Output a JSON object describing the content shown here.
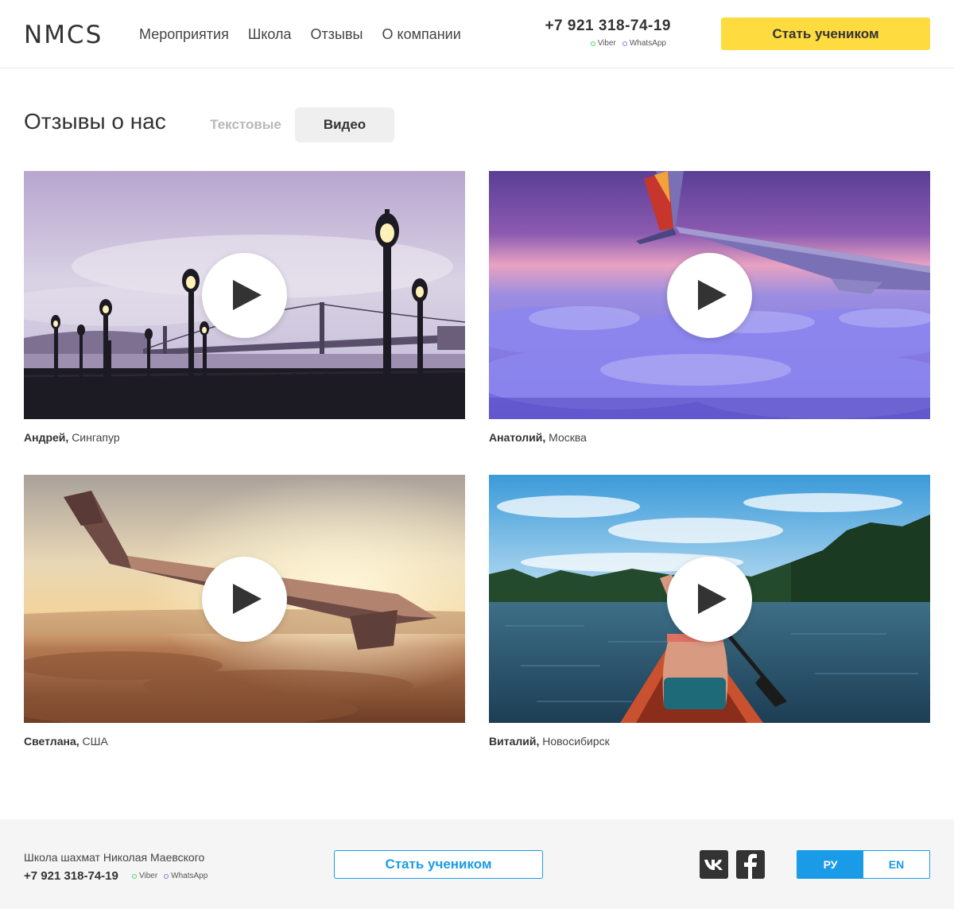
{
  "header": {
    "logo": "NMCS",
    "nav": [
      "Мероприятия",
      "Школа",
      "Отзывы",
      "О компании"
    ],
    "phone": "+7 921 318-74-19",
    "messengers": [
      {
        "label": "Viber",
        "color": "#4cd964"
      },
      {
        "label": "WhatsApp",
        "color": "#8f7be0"
      }
    ],
    "cta": "Стать учеником",
    "cta_color": "#fedb3f"
  },
  "reviews": {
    "title": "Отзывы о нас",
    "tabs": {
      "text": "Текстовые",
      "video": "Видео"
    },
    "active_tab": "video",
    "videos": [
      {
        "name": "Андрей,",
        "city": "Сингапур",
        "scene": "bridge-lamps"
      },
      {
        "name": "Анатолий,",
        "city": "Москва",
        "scene": "plane-wing-purple-clouds"
      },
      {
        "name": "Светлана,",
        "city": "США",
        "scene": "plane-wing-sunset"
      },
      {
        "name": "Виталий,",
        "city": "Новосибирск",
        "scene": "canoe-lake"
      }
    ]
  },
  "footer": {
    "school": "Школа шахмат Николая Маевского",
    "phone": "+7 921 318-74-19",
    "messengers": [
      "Viber",
      "WhatsApp"
    ],
    "cta": "Стать учеником",
    "social": [
      "vk-icon",
      "facebook-icon"
    ],
    "lang": {
      "ru": "РУ",
      "en": "EN",
      "active": "ru"
    },
    "accent": "#1a9be8"
  }
}
